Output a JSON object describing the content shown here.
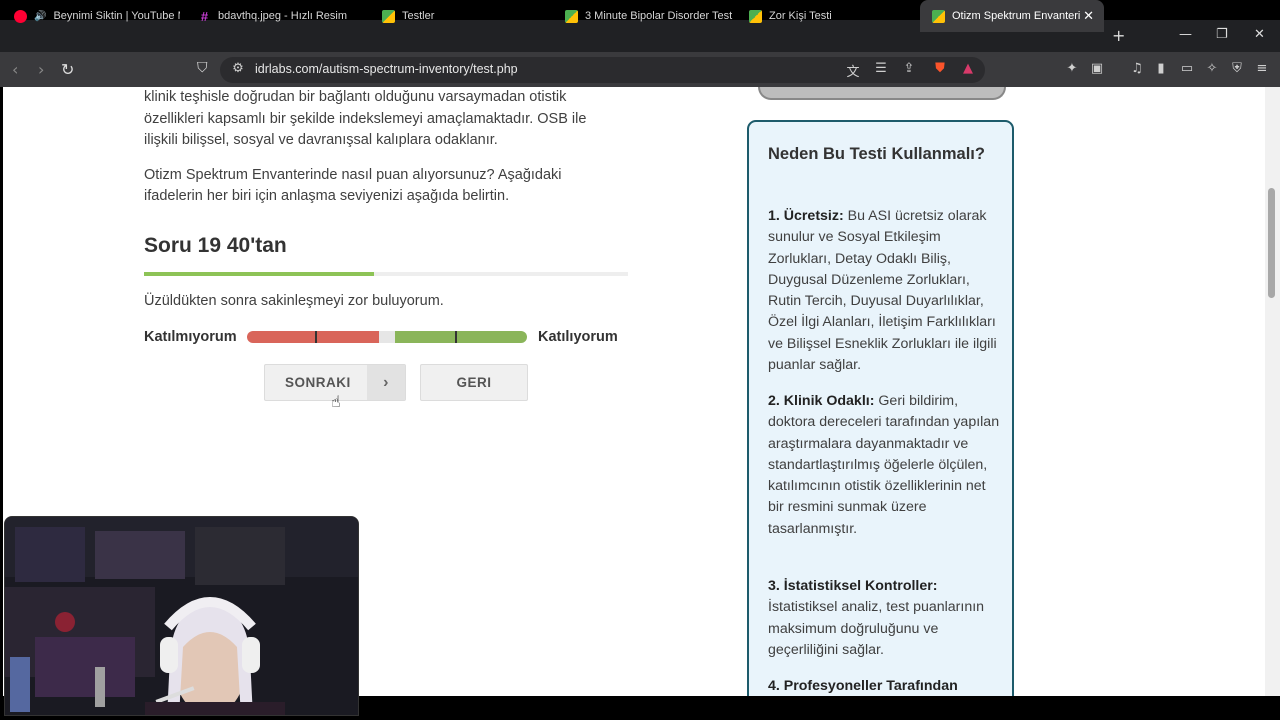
{
  "tabs": [
    {
      "title": "Beynimi Siktin | YouTube Mu",
      "icon": "youtube-icon"
    },
    {
      "title": "bdavthq.jpeg - Hızlı Resim",
      "icon": "image-icon"
    },
    {
      "title": "Testler",
      "icon": "idrlabs-icon"
    },
    {
      "title": "3 Minute Bipolar Disorder Test",
      "icon": "idrlabs-icon"
    },
    {
      "title": "Zor Kişi Testi",
      "icon": "idrlabs-icon"
    },
    {
      "title": "Otizm Spektrum Envanteri",
      "icon": "idrlabs-icon",
      "active": true
    }
  ],
  "address": {
    "url": "idrlabs.com/autism-spectrum-inventory/test.php"
  },
  "intro": {
    "p1": "klinik teşhisle doğrudan bir bağlantı olduğunu varsaymadan otistik özellikleri kapsamlı bir şekilde indekslemeyi amaçlamaktadır. OSB ile ilişkili bilişsel, sosyal ve davranışsal kalıplara odaklanır.",
    "p2": "Otizm Spektrum Envanterinde nasıl puan alıyorsunuz? Aşağıdaki ifadelerin her biri için anlaşma seviyenizi aşağıda belirtin."
  },
  "question": {
    "title": "Soru 19 40'tan",
    "progress": 0.475,
    "text": "Üzüldükten sonra sakinleşmeyi zor buluyorum.",
    "disagree_label": "Katılmıyorum",
    "agree_label": "Katılıyorum"
  },
  "buttons": {
    "next": "SONRAKI",
    "back": "GERI"
  },
  "sidebar": {
    "heading": "Neden Bu Testi Kullanmalı?",
    "items": [
      {
        "label": "1. Ücretsiz:",
        "text": "Bu ASI ücretsiz olarak sunulur ve Sosyal Etkileşim Zorlukları, Detay Odaklı Biliş, Duygusal Düzenleme Zorlukları, Rutin Tercih, Duyusal Duyarlılıklar, Özel İlgi Alanları, İletişim Farklılıkları ve Bilişsel Esneklik Zorlukları ile ilgili puanlar sağlar."
      },
      {
        "label": "2. Klinik Odaklı:",
        "text": "Geri bildirim, doktora dereceleri tarafından yapılan araştırmalara dayanmaktadır ve standartlaştırılmış öğelerle ölçülen, katılımcının otistik özelliklerinin net bir resmini sunmak üzere tasarlanmıştır."
      },
      {
        "label": "3. İstatistiksel Kontroller:",
        "text": "İstatistiksel analiz, test puanlarının maksimum doğruluğunu ve geçerliliğini sağlar."
      },
      {
        "label": "4. Profesyoneller Tarafından",
        "text": ""
      }
    ]
  },
  "colors": {
    "accent_green": "#8dc356",
    "box_border": "#1d5b6b",
    "box_bg": "#e9f4fb",
    "scale_red": "#d9655a",
    "scale_green": "#8ab55a"
  }
}
